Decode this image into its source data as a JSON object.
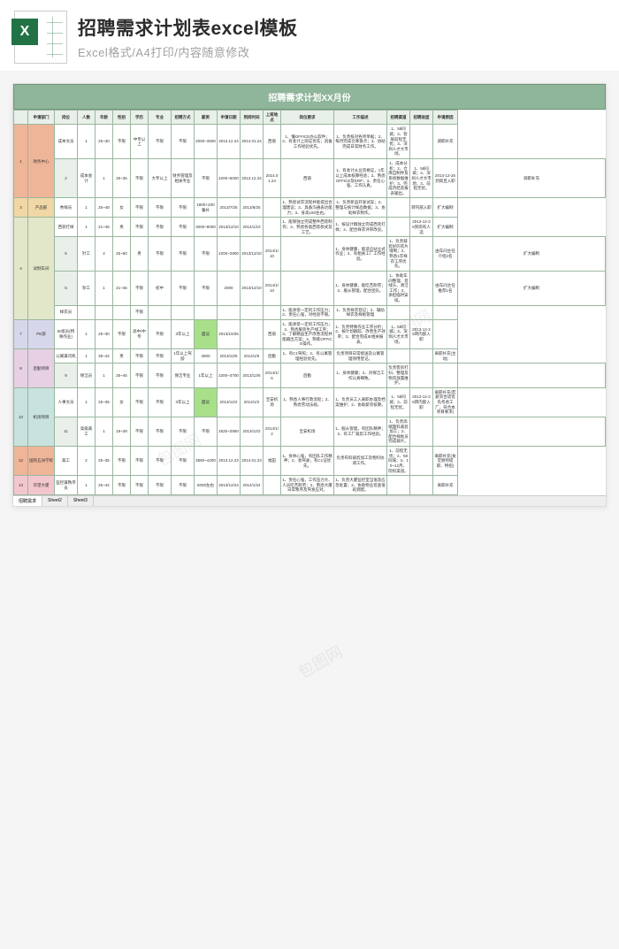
{
  "header": {
    "title": "招聘需求计划表excel模板",
    "subtitle": "Excel格式/A4打印/内容随意修改",
    "icon_label": "X"
  },
  "watermark": "包图网",
  "sheet": {
    "title": "招聘需求计划XX月份",
    "columns": [
      "",
      "申请部门",
      "岗位",
      "人数",
      "年龄",
      "性别",
      "学历",
      "专业",
      "招聘方式",
      "薪资",
      "申请日期",
      "到岗时间",
      "上班地点",
      "岗位要求",
      "工作描述",
      "招聘渠道",
      "招聘进度",
      "申请原因"
    ],
    "tabs": [
      "招聘需求",
      "Sheet2",
      "Sheet3"
    ],
    "active_tab": 0,
    "rows": [
      {
        "idx": "1",
        "dept": "财务中心",
        "dept_cls": "dept-1",
        "dept_rows": 2,
        "pos": "成本文员",
        "num": "1",
        "age": "25~30",
        "sex": "不限",
        "edu": "中专以上",
        "major": "不限",
        "method": "不限",
        "salary": "2000~3500",
        "apply": "2013.12.24",
        "arrive": "2014.01.24",
        "loc": "西丽",
        "req": "1、懂OFFICE办公软件；2、有会计上岗证优先；具备工作经验优先。",
        "work": "1、负责核对各项单据；2、每月完成仓库盘点；3、协助完成日常财务工作。",
        "channel": "1、58同城；2、智联前程无忧；3、深圳人才大市场。",
        "progress": "",
        "reason": "调职补充"
      },
      {
        "idx": "2",
        "dept": "",
        "pos": "成本会计",
        "num": "1",
        "age": "25~35",
        "sex": "不限",
        "edu": "大专以上",
        "major": "财务管理及相关专业",
        "method": "不限",
        "salary": "4200~5000",
        "apply": "2013.12.24",
        "arrive": "2014.01.24",
        "loc": "西丽",
        "req": "1、有会计从业资格证，1年以上成本核算经验；2、熟悉OFFICE及ERP；3、责任心强、工作认真。",
        "work": "1、成本分析；2、仓库自制件及系统数据维护；3、完成月结及报表输出。",
        "channel": "1、58同城；2、深圳人才大市场；3、前程无忧。",
        "progress": "2013-12-25到岗且入职",
        "reason": "调职补充"
      },
      {
        "idx": "3",
        "dept": "产品部",
        "dept_cls": "dept-2",
        "dept_rows": 1,
        "pos": "秀样员",
        "num": "1",
        "age": "25~48",
        "sex": "女",
        "edu": "不限",
        "major": "不限",
        "method": "不限",
        "salary": "1800+200餐补",
        "apply": "2013/7/25",
        "arrive": "2013/8/25",
        "loc": "",
        "req": "1、熟悉试衣流程并能提出合理建议；2、具备沟通表达能力；3、身高160左右。",
        "work": "1、负责新品开发试穿；2、整理与统计样品数据；3、协助样衣制作。",
        "channel": "",
        "progress": "转内部入职",
        "reason": "扩大编制"
      },
      {
        "idx": "4",
        "dept": "试制车间",
        "dept_cls": "dept-3",
        "dept_rows": 4,
        "pos": "西装打样",
        "num": "1",
        "age": "21~45",
        "sex": "男",
        "edu": "不限",
        "major": "不限",
        "method": "不限",
        "salary": "3000~8000",
        "apply": "2013/12/10",
        "arrive": "2014/1/10",
        "loc": "",
        "req": "1、能够独立完成整件西装制作；2、熟悉各类西装款式及工艺。",
        "work": "1、按设计稿独立完成西装打样；2、配合样衣评审改良。",
        "channel": "",
        "progress": "2013-12-25到岗有人选",
        "reason": "扩大编制"
      },
      {
        "idx": "5",
        "dept": "",
        "pos": "针工",
        "num": "2",
        "age": "25~50",
        "sex": "男",
        "edu": "不限",
        "major": "不限",
        "method": "不限",
        "salary": "2200~2800",
        "apply": "2013/12/10",
        "arrive": "2014/1/10",
        "loc": "",
        "req": "1、身体健康，能适应站立式作业；2、有相关工厂工作经验。",
        "work": "1、负责裁剪好的衣片缝制；2、熟悉1年样衣工序优先。",
        "channel": "",
        "progress": "由车间主任介绍2名",
        "reason": "扩大编制"
      },
      {
        "idx": "6",
        "dept": "",
        "pos": "杂工",
        "num": "1",
        "age": "21~45",
        "sex": "不限",
        "edu": "初中",
        "major": "不限",
        "method": "不限",
        "salary": "2000",
        "apply": "2013/12/10",
        "arrive": "2014/1/10",
        "loc": "",
        "req": "1、身体健康，能吃苦耐劳；2、服从管理，配合团队。",
        "work": "1、协助车间整理、剪线头、清洁工作；2、承担临时安排。",
        "channel": "",
        "progress": "由车间主任推荐1名",
        "reason": "扩大编制"
      },
      {
        "idx": "",
        "dept": "",
        "pos": "样衣员",
        "num": "",
        "age": "",
        "sex": "",
        "edu": "不限",
        "major": "",
        "method": "",
        "salary": "",
        "apply": "",
        "arrive": "",
        "loc": "",
        "req": "1、能承受一定的工作压力；2、责任心强，对经验不限。",
        "work": "1、负责样衣登记；2、辅助样衣及样板管理",
        "channel": "",
        "progress": "",
        "reason": ""
      },
      {
        "idx": "7",
        "dept": "PE部",
        "dept_cls": "dept-4",
        "dept_rows": 1,
        "pos": "IE组员(特殊作业)",
        "num": "1",
        "age": "25~30",
        "sex": "不限",
        "edu": "高中/中专",
        "major": "不限",
        "method": "3年以上",
        "salary_cls": "hl",
        "salary": "面议",
        "apply": "2013/10/25",
        "arrive": "",
        "loc": "西丽",
        "req": "1、能承受一定的工作压力；2、熟悉服装生产线工序；3、了解精益生产改善流程并能输出方案；4、熟练OFFICE操作。",
        "work": "1、负责特殊作业工序分析；2、按计划跟踪、改善生产效率；3、配合完成IE相关报表。",
        "channel": "1、58同城；2、深圳人才大市场。",
        "progress": "2013-12-25转内部入职",
        "reason": ""
      },
      {
        "idx": "8",
        "dept": "后勤项目",
        "dept_cls": "dept-5",
        "dept_rows": 2,
        "pos": "公寓兼司机",
        "num": "1",
        "age": "35~42",
        "sex": "男",
        "edu": "不限",
        "major": "不限",
        "method": "1年以上驾龄",
        "salary": "2800",
        "apply": "2013/12/6",
        "arrive": "2014/1/6",
        "loc": "后勤",
        "req": "1、有C1驾照；2、有公寓管理经验优先。",
        "work": "负责项目日常接送及公寓管理领用登记。",
        "channel": "",
        "progress": "",
        "reason": "离职补充(主动)"
      },
      {
        "idx": "9",
        "dept": "",
        "pos": "保洁员",
        "num": "1",
        "age": "25~45",
        "sex": "不限",
        "edu": "不限",
        "major": "保洁专业",
        "method": "1年以上",
        "salary": "2200~3700",
        "apply": "2013/12/6",
        "arrive": "2014/1/6",
        "loc": "后勤",
        "req": "1、身体健康；2、对保洁工作认真细致。",
        "work": "负责客房打扫、整理及物资放置维护。",
        "channel": "",
        "progress": "",
        "reason": ""
      },
      {
        "idx": "10",
        "dept": "机场项目",
        "dept_cls": "dept-6",
        "dept_rows": 2,
        "pos": "人事文员",
        "num": "1",
        "age": "25~35",
        "sex": "女",
        "edu": "不限",
        "major": "不限",
        "method": "3年以上",
        "salary_cls": "hl",
        "salary": "面议",
        "apply": "2013/12/2",
        "arrive": "2014/1/2",
        "loc": "宝安机场",
        "req": "1、熟悉人事行政流程；2、熟悉劳动法规。",
        "work": "1、负责员工入离职办理及档案维护；2、协助薪资核算。",
        "channel": "1、58同城；2、前程无忧。",
        "progress": "2013-12-25转内部入职",
        "reason": "离职补充(若薪资合适优先考虑工厂，符合本项目要求)"
      },
      {
        "idx": "11",
        "dept": "",
        "pos": "高级裁工",
        "num": "1",
        "age": "18~28",
        "sex": "不限",
        "edu": "不限",
        "major": "不限",
        "method": "不限",
        "salary": "2520~2950",
        "apply": "2013/12/2",
        "arrive": "2014/1/2",
        "loc": "宝安机场",
        "req": "1、服从管理，有团队精神；2、有工厂裁剪工作经验。",
        "work": "1、负责高端面料裁剪加工；2、配合样板员完成裁片。",
        "channel": "",
        "progress": "",
        "reason": ""
      },
      {
        "idx": "12",
        "dept": "国际五洲学校",
        "dept_cls": "dept-1",
        "dept_rows": 1,
        "pos": "裁工",
        "num": "2",
        "age": "25~35",
        "sex": "不限",
        "edu": "不限",
        "major": "不限",
        "method": "不限",
        "salary": "3580~4200",
        "apply": "2013.12.23",
        "arrive": "2014.01.23",
        "loc": "福田",
        "req": "1、身体心强，有团队工作精神；2、会驾驶，有C1证优先。",
        "work": "负责布料裁剪加工及物料协调工作。",
        "channel": "1、前程无忧；2、58同城；3、10~12月、院校渠道。",
        "progress": "",
        "reason": "离职补充(食堂厨师提职、特招)"
      },
      {
        "idx": "13",
        "dept": "华望大厦",
        "dept_cls": "dept-7",
        "dept_rows": 1,
        "pos": "监控兼秩序员",
        "num": "1",
        "age": "25~42",
        "sex": "不限",
        "edu": "不限",
        "major": "不限",
        "method": "不限",
        "salary": "5000左右",
        "apply": "2013/12/24",
        "arrive": "2014/1/24",
        "loc": "",
        "req": "1、责任心强，工作压力大、人员吃苦耐劳；2、熟悉大厦日常秩序及突发应对。",
        "work": "1、负责大厦监控室当值及应急处置；2、协助物业巡查值班调配。",
        "channel": "",
        "progress": "",
        "reason": "离职补充"
      }
    ]
  }
}
